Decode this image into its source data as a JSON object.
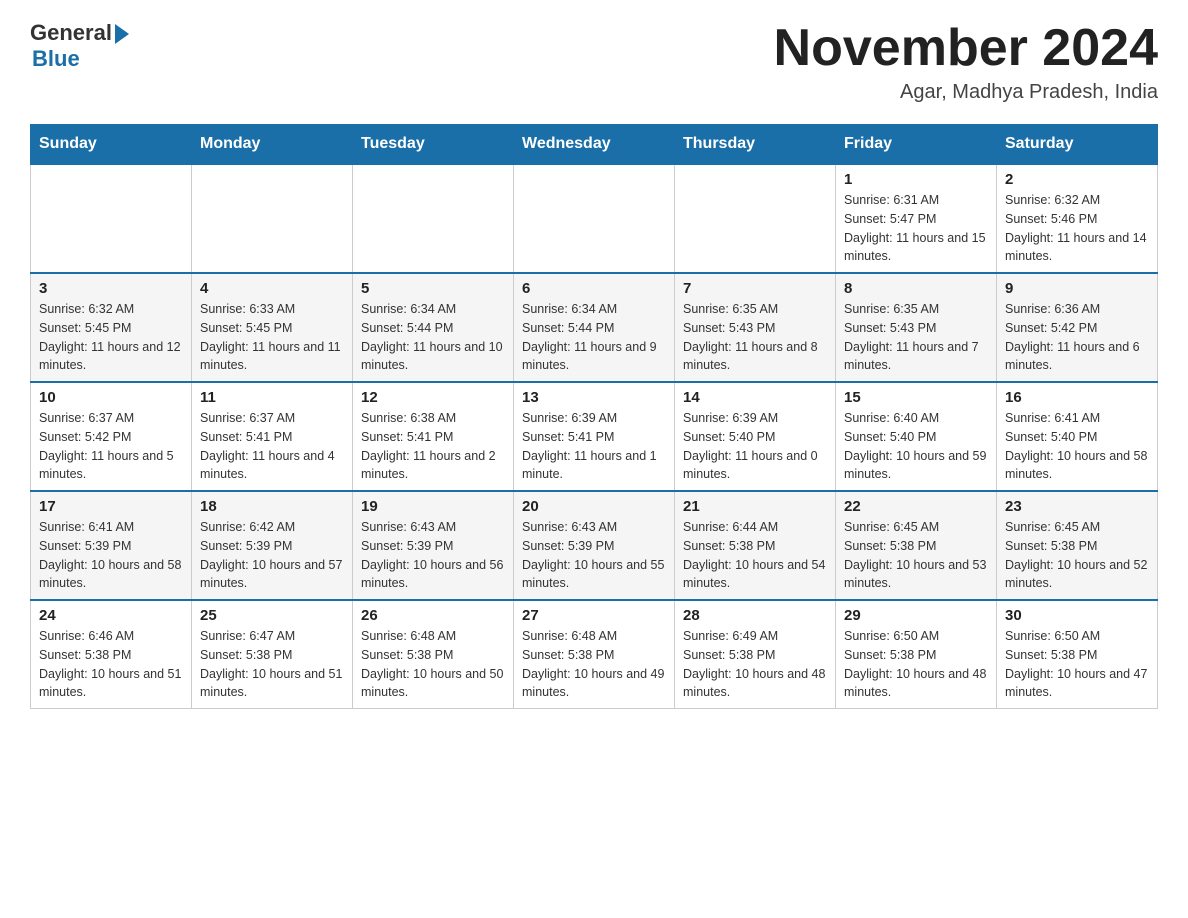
{
  "header": {
    "logo": {
      "general": "General",
      "blue": "Blue"
    },
    "title": "November 2024",
    "subtitle": "Agar, Madhya Pradesh, India"
  },
  "days_of_week": [
    "Sunday",
    "Monday",
    "Tuesday",
    "Wednesday",
    "Thursday",
    "Friday",
    "Saturday"
  ],
  "weeks": [
    [
      {
        "day": "",
        "info": ""
      },
      {
        "day": "",
        "info": ""
      },
      {
        "day": "",
        "info": ""
      },
      {
        "day": "",
        "info": ""
      },
      {
        "day": "",
        "info": ""
      },
      {
        "day": "1",
        "info": "Sunrise: 6:31 AM\nSunset: 5:47 PM\nDaylight: 11 hours and 15 minutes."
      },
      {
        "day": "2",
        "info": "Sunrise: 6:32 AM\nSunset: 5:46 PM\nDaylight: 11 hours and 14 minutes."
      }
    ],
    [
      {
        "day": "3",
        "info": "Sunrise: 6:32 AM\nSunset: 5:45 PM\nDaylight: 11 hours and 12 minutes."
      },
      {
        "day": "4",
        "info": "Sunrise: 6:33 AM\nSunset: 5:45 PM\nDaylight: 11 hours and 11 minutes."
      },
      {
        "day": "5",
        "info": "Sunrise: 6:34 AM\nSunset: 5:44 PM\nDaylight: 11 hours and 10 minutes."
      },
      {
        "day": "6",
        "info": "Sunrise: 6:34 AM\nSunset: 5:44 PM\nDaylight: 11 hours and 9 minutes."
      },
      {
        "day": "7",
        "info": "Sunrise: 6:35 AM\nSunset: 5:43 PM\nDaylight: 11 hours and 8 minutes."
      },
      {
        "day": "8",
        "info": "Sunrise: 6:35 AM\nSunset: 5:43 PM\nDaylight: 11 hours and 7 minutes."
      },
      {
        "day": "9",
        "info": "Sunrise: 6:36 AM\nSunset: 5:42 PM\nDaylight: 11 hours and 6 minutes."
      }
    ],
    [
      {
        "day": "10",
        "info": "Sunrise: 6:37 AM\nSunset: 5:42 PM\nDaylight: 11 hours and 5 minutes."
      },
      {
        "day": "11",
        "info": "Sunrise: 6:37 AM\nSunset: 5:41 PM\nDaylight: 11 hours and 4 minutes."
      },
      {
        "day": "12",
        "info": "Sunrise: 6:38 AM\nSunset: 5:41 PM\nDaylight: 11 hours and 2 minutes."
      },
      {
        "day": "13",
        "info": "Sunrise: 6:39 AM\nSunset: 5:41 PM\nDaylight: 11 hours and 1 minute."
      },
      {
        "day": "14",
        "info": "Sunrise: 6:39 AM\nSunset: 5:40 PM\nDaylight: 11 hours and 0 minutes."
      },
      {
        "day": "15",
        "info": "Sunrise: 6:40 AM\nSunset: 5:40 PM\nDaylight: 10 hours and 59 minutes."
      },
      {
        "day": "16",
        "info": "Sunrise: 6:41 AM\nSunset: 5:40 PM\nDaylight: 10 hours and 58 minutes."
      }
    ],
    [
      {
        "day": "17",
        "info": "Sunrise: 6:41 AM\nSunset: 5:39 PM\nDaylight: 10 hours and 58 minutes."
      },
      {
        "day": "18",
        "info": "Sunrise: 6:42 AM\nSunset: 5:39 PM\nDaylight: 10 hours and 57 minutes."
      },
      {
        "day": "19",
        "info": "Sunrise: 6:43 AM\nSunset: 5:39 PM\nDaylight: 10 hours and 56 minutes."
      },
      {
        "day": "20",
        "info": "Sunrise: 6:43 AM\nSunset: 5:39 PM\nDaylight: 10 hours and 55 minutes."
      },
      {
        "day": "21",
        "info": "Sunrise: 6:44 AM\nSunset: 5:38 PM\nDaylight: 10 hours and 54 minutes."
      },
      {
        "day": "22",
        "info": "Sunrise: 6:45 AM\nSunset: 5:38 PM\nDaylight: 10 hours and 53 minutes."
      },
      {
        "day": "23",
        "info": "Sunrise: 6:45 AM\nSunset: 5:38 PM\nDaylight: 10 hours and 52 minutes."
      }
    ],
    [
      {
        "day": "24",
        "info": "Sunrise: 6:46 AM\nSunset: 5:38 PM\nDaylight: 10 hours and 51 minutes."
      },
      {
        "day": "25",
        "info": "Sunrise: 6:47 AM\nSunset: 5:38 PM\nDaylight: 10 hours and 51 minutes."
      },
      {
        "day": "26",
        "info": "Sunrise: 6:48 AM\nSunset: 5:38 PM\nDaylight: 10 hours and 50 minutes."
      },
      {
        "day": "27",
        "info": "Sunrise: 6:48 AM\nSunset: 5:38 PM\nDaylight: 10 hours and 49 minutes."
      },
      {
        "day": "28",
        "info": "Sunrise: 6:49 AM\nSunset: 5:38 PM\nDaylight: 10 hours and 48 minutes."
      },
      {
        "day": "29",
        "info": "Sunrise: 6:50 AM\nSunset: 5:38 PM\nDaylight: 10 hours and 48 minutes."
      },
      {
        "day": "30",
        "info": "Sunrise: 6:50 AM\nSunset: 5:38 PM\nDaylight: 10 hours and 47 minutes."
      }
    ]
  ]
}
